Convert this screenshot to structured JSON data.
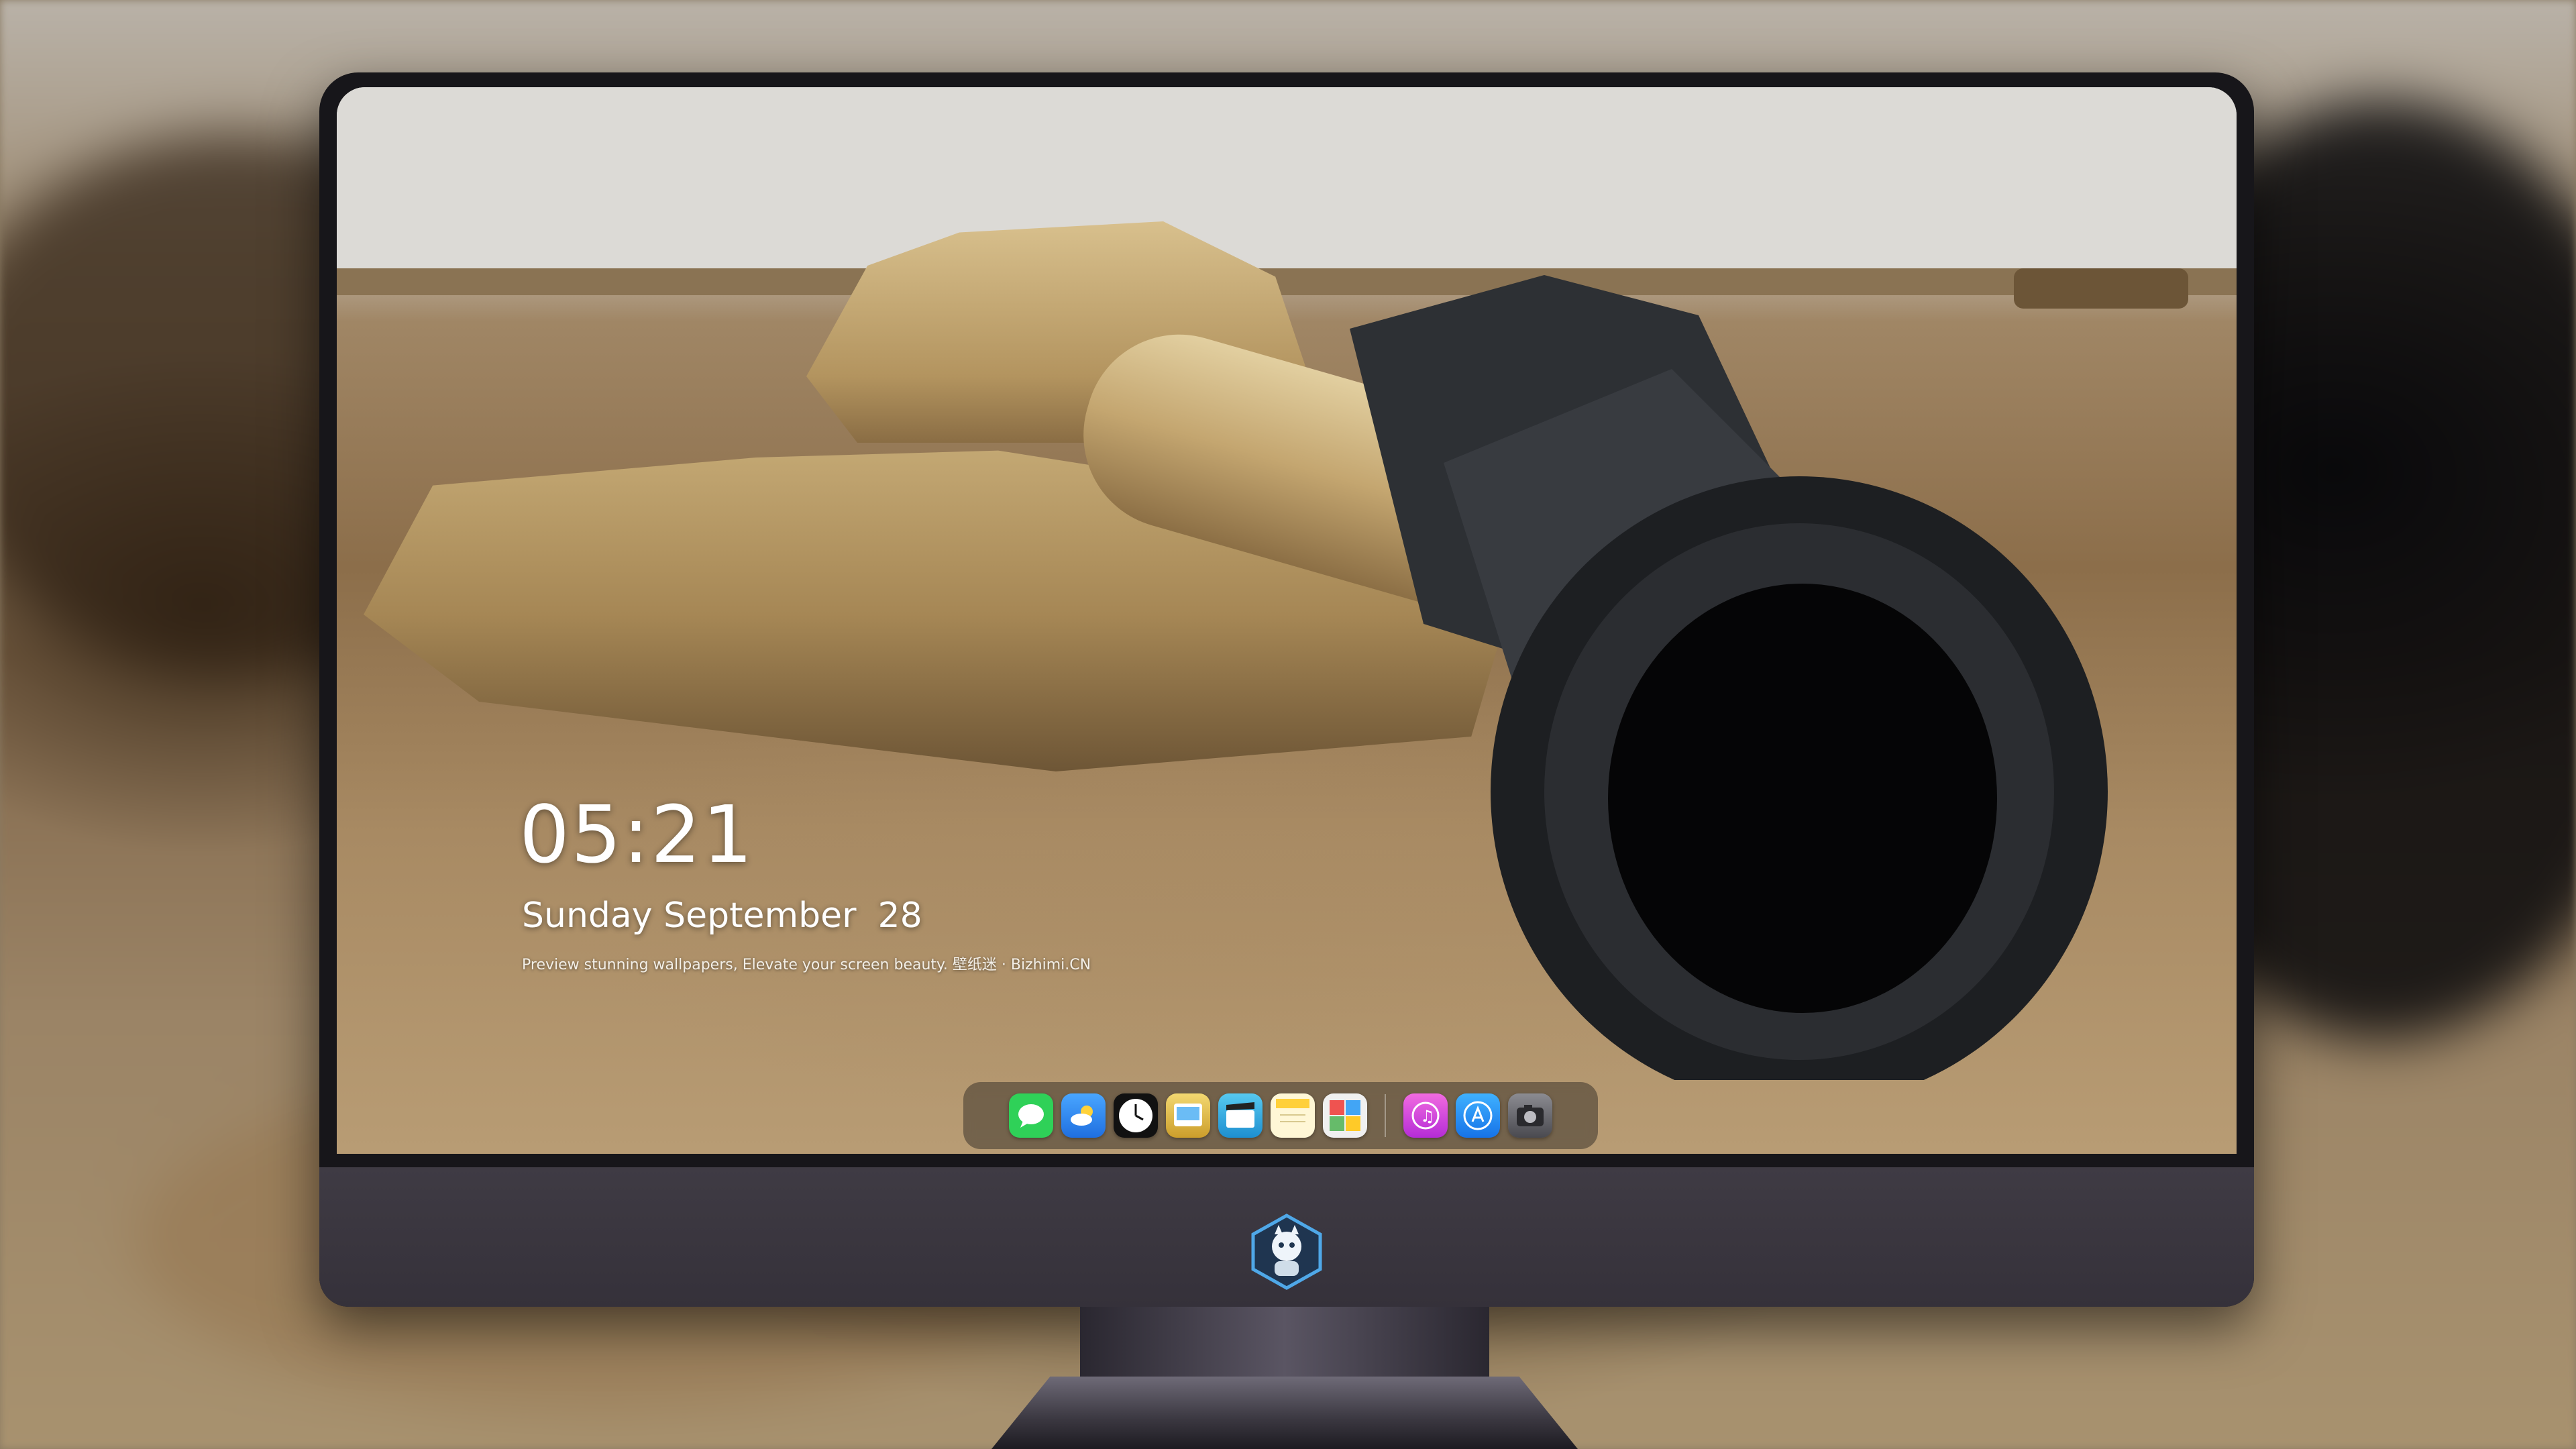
{
  "lockscreen": {
    "time": "05:21",
    "weekday": "Sunday",
    "month": "September",
    "day": "28",
    "tagline": "Preview stunning wallpapers, Elevate your screen beauty. 壁纸迷 · Bizhimi.CN"
  },
  "dock": {
    "apps": [
      {
        "icon": "messages-icon",
        "color": "#2fd158"
      },
      {
        "icon": "weather-icon",
        "color": "#2e8cf0"
      },
      {
        "icon": "clock-icon",
        "color": "#f5f5f5"
      },
      {
        "icon": "preview-icon",
        "color": "#e8c24a"
      },
      {
        "icon": "clips-icon",
        "color": "#3db5e6"
      },
      {
        "icon": "notes-icon",
        "color": "#ffe27a"
      },
      {
        "icon": "photo-booth-icon",
        "color": "#5a8fd8"
      },
      {
        "icon": "itunes-icon",
        "color": "#e040d0"
      },
      {
        "icon": "app-store-icon",
        "color": "#1a8cf5"
      },
      {
        "icon": "screenshot-icon",
        "color": "#6b6b70"
      }
    ]
  },
  "brand": {
    "icon": "mascot-logo-icon"
  }
}
